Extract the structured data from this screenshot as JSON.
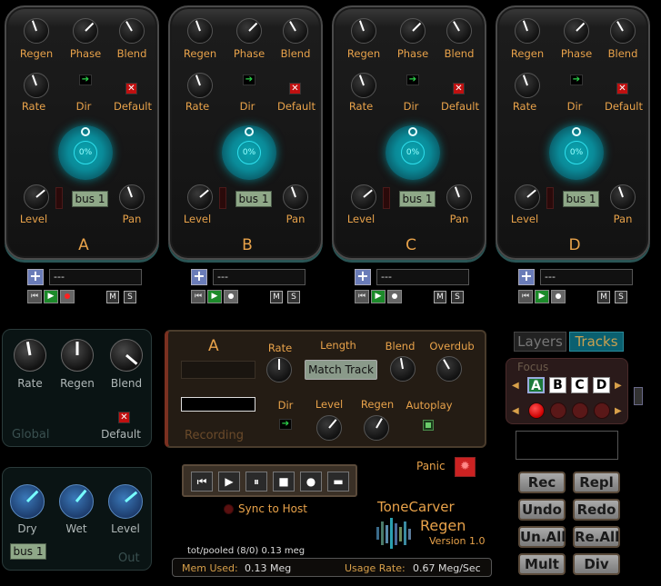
{
  "tracks": [
    {
      "letter": "A",
      "bus": "bus 1",
      "orb": "0%",
      "slot": "---",
      "last_rec": true
    },
    {
      "letter": "B",
      "bus": "bus 1",
      "orb": "0%",
      "slot": "---",
      "last_rec": false
    },
    {
      "letter": "C",
      "bus": "bus 1",
      "orb": "0%",
      "slot": "---",
      "last_rec": false
    },
    {
      "letter": "D",
      "bus": "bus 1",
      "orb": "0%",
      "slot": "---",
      "last_rec": false
    }
  ],
  "track_labels": {
    "regen": "Regen",
    "phase": "Phase",
    "blend": "Blend",
    "rate": "Rate",
    "dir": "Dir",
    "default": "Default",
    "level": "Level",
    "pan": "Pan"
  },
  "ms": {
    "m": "M",
    "s": "S"
  },
  "global": {
    "rate": "Rate",
    "regen": "Regen",
    "blend": "Blend",
    "title": "Global",
    "default": "Default"
  },
  "out": {
    "dry": "Dry",
    "wet": "Wet",
    "level": "Level",
    "bus": "bus 1",
    "title": "Out"
  },
  "looper": {
    "track": "A",
    "rate": "Rate",
    "length": "Length",
    "match_track": "Match Track",
    "blend": "Blend",
    "overdub": "Overdub",
    "dir": "Dir",
    "level": "Level",
    "regen": "Regen",
    "autoplay": "Autoplay",
    "status": "Recording"
  },
  "panic": "Panic",
  "sync": "Sync to Host",
  "brand": {
    "name": "ToneCarver",
    "product": "Regen",
    "version": "Version 1.0"
  },
  "tabs": {
    "layers": "Layers",
    "tracks": "Tracks"
  },
  "focus": {
    "title": "Focus",
    "letters": [
      "A",
      "B",
      "C",
      "D"
    ]
  },
  "buttons": [
    "Rec",
    "Repl",
    "Undo",
    "Redo",
    "Un.All",
    "Re.All",
    "Mult",
    "Div"
  ],
  "status": {
    "pool": "tot/pooled (8/0) 0.13 meg",
    "mem_label": "Mem Used:",
    "mem_value": "0.13 Meg",
    "usage_label": "Usage Rate:",
    "usage_value": "0.67 Meg/Sec"
  },
  "colors": {
    "accent": "#e8a24a",
    "orb": "#0aa5b0",
    "focus_active": "#1c7a3a"
  }
}
